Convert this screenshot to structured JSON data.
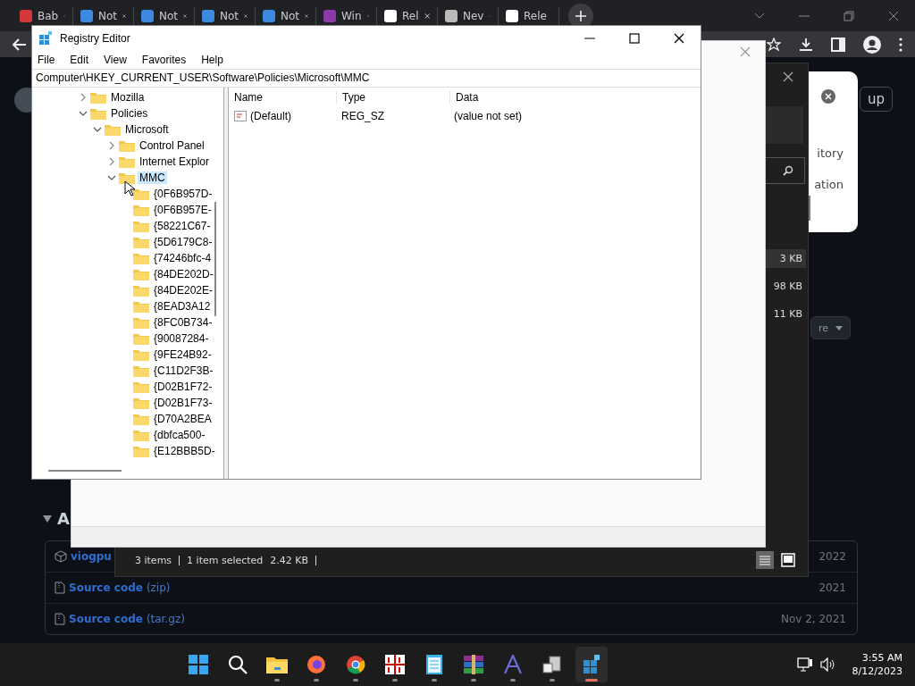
{
  "browser": {
    "tabs": [
      {
        "title": "Bab",
        "kind": "red"
      },
      {
        "title": "Not",
        "kind": "notes"
      },
      {
        "title": "Not",
        "kind": "notes"
      },
      {
        "title": "Not",
        "kind": "notes"
      },
      {
        "title": "Not",
        "kind": "notes"
      },
      {
        "title": "Win",
        "kind": "archive"
      },
      {
        "title": "Rel",
        "kind": "github"
      },
      {
        "title": "Nev",
        "kind": "chrome"
      },
      {
        "title": "Rele",
        "kind": "github"
      }
    ]
  },
  "github_page": {
    "signup_button": "up",
    "menu_items": [
      "itory",
      "ation"
    ],
    "sizes": [
      "3 KB",
      "98 KB",
      "11 KB"
    ],
    "dropdown_label": "re",
    "assets_heading": "A",
    "assets": [
      {
        "kind": "package",
        "name": "viogpu",
        "date": "2022"
      },
      {
        "kind": "archive",
        "name": "Source code",
        "detail": "(zip)",
        "date": "2021"
      },
      {
        "kind": "archive",
        "name": "Source code",
        "detail": "(tar.gz)",
        "date": "Nov 2, 2021"
      }
    ]
  },
  "file_dialog": {
    "status": [
      "3 items",
      "1 item selected",
      "2.42 KB"
    ]
  },
  "registry": {
    "title": "Registry Editor",
    "menu": [
      "File",
      "Edit",
      "View",
      "Favorites",
      "Help"
    ],
    "address": "Computer\\HKEY_CURRENT_USER\\Software\\Policies\\Microsoft\\MMC",
    "tree": [
      {
        "label": "Mozilla",
        "expanded": false,
        "selected": false
      },
      {
        "label": "Policies",
        "expanded": true,
        "selected": false,
        "children": [
          {
            "label": "Microsoft",
            "expanded": true,
            "selected": false,
            "children": [
              {
                "label": "Control Panel",
                "expanded": false,
                "selected": false
              },
              {
                "label": "Internet Explor",
                "expanded": false,
                "selected": false
              },
              {
                "label": "MMC",
                "expanded": true,
                "selected": true,
                "children": [
                  {
                    "label": "{0F6B957D-",
                    "selected": false
                  },
                  {
                    "label": "{0F6B957E-",
                    "selected": false
                  },
                  {
                    "label": "{58221C67-",
                    "selected": false
                  },
                  {
                    "label": "{5D6179C8-",
                    "selected": false
                  },
                  {
                    "label": "{74246bfc-4",
                    "selected": false
                  },
                  {
                    "label": "{84DE202D-",
                    "selected": false
                  },
                  {
                    "label": "{84DE202E-",
                    "selected": false
                  },
                  {
                    "label": "{8EAD3A12",
                    "selected": false
                  },
                  {
                    "label": "{8FC0B734-",
                    "selected": false
                  },
                  {
                    "label": "{90087284-",
                    "selected": false
                  },
                  {
                    "label": "{9FE24B92-",
                    "selected": false
                  },
                  {
                    "label": "{C11D2F3B-",
                    "selected": false
                  },
                  {
                    "label": "{D02B1F72-",
                    "selected": false
                  },
                  {
                    "label": "{D02B1F73-",
                    "selected": false
                  },
                  {
                    "label": "{D70A2BEA",
                    "selected": false
                  },
                  {
                    "label": "{dbfca500-",
                    "selected": false
                  },
                  {
                    "label": "{E12BBB5D-",
                    "selected": false
                  }
                ]
              }
            ]
          }
        ]
      }
    ],
    "columns": [
      "Name",
      "Type",
      "Data"
    ],
    "values": [
      {
        "name": "(Default)",
        "type": "REG_SZ",
        "data": "(value not set)"
      }
    ]
  },
  "taskbar": {
    "apps": [
      {
        "kind": "start",
        "running": false,
        "active": false
      },
      {
        "kind": "search",
        "running": false,
        "active": false
      },
      {
        "kind": "folder",
        "running": true,
        "active": false
      },
      {
        "kind": "firefox",
        "running": true,
        "active": false
      },
      {
        "kind": "chrome",
        "running": true,
        "active": false
      },
      {
        "kind": "grid",
        "running": true,
        "active": false
      },
      {
        "kind": "notepad",
        "running": true,
        "active": false
      },
      {
        "kind": "archive",
        "running": true,
        "active": false
      },
      {
        "kind": "font",
        "running": true,
        "active": false
      },
      {
        "kind": "installer",
        "running": true,
        "active": false
      },
      {
        "kind": "registry",
        "running": true,
        "active": true
      }
    ],
    "time": "3:55 AM",
    "date": "8/12/2023"
  }
}
